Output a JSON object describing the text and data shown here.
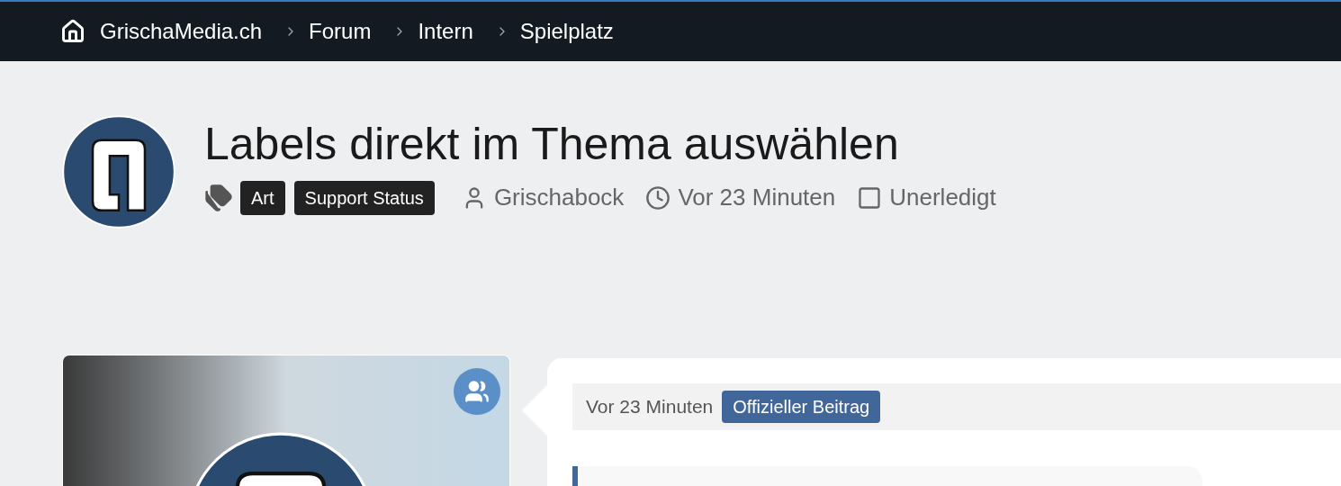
{
  "breadcrumbs": [
    {
      "label": "GrischaMedia.ch",
      "kind": "home"
    },
    {
      "label": "Forum",
      "kind": "crumb"
    },
    {
      "label": "Intern",
      "kind": "crumb"
    },
    {
      "label": "Spielplatz",
      "kind": "crumb"
    }
  ],
  "thread": {
    "title": "Labels direkt im Thema auswählen",
    "labels": [
      "Art",
      "Support Status"
    ],
    "author": "Grischabock",
    "time": "Vor 23 Minuten",
    "status": "Unerledigt",
    "done": false
  },
  "post": {
    "time": "Vor 23 Minuten",
    "badge": "Offizieller Beitrag"
  }
}
